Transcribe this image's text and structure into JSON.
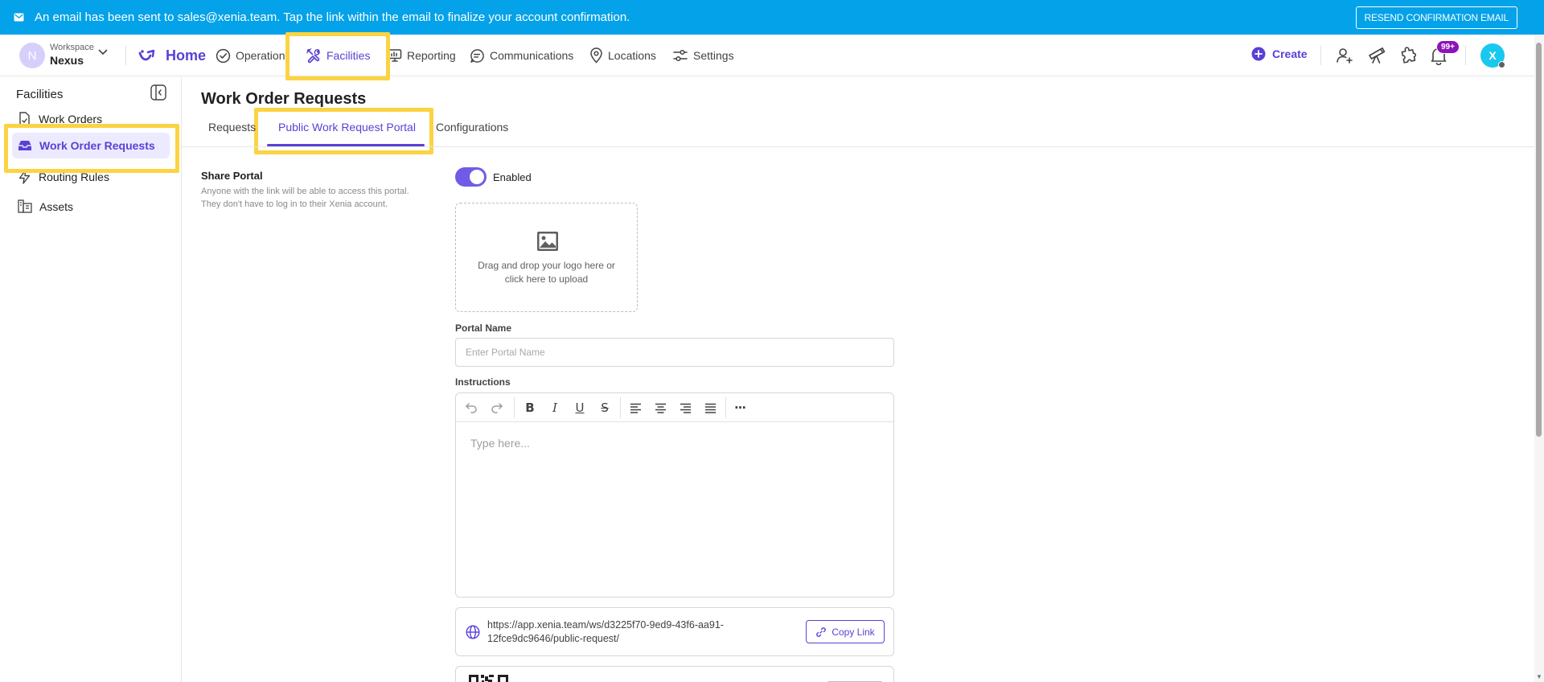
{
  "banner": {
    "message": "An email has been sent to sales@xenia.team. Tap the link within the email to finalize your account confirmation.",
    "resend_label": "RESEND CONFIRMATION EMAIL"
  },
  "workspace": {
    "initial": "N",
    "label": "Workspace",
    "name": "Nexus"
  },
  "nav": {
    "home": "Home",
    "operations": "Operations",
    "facilities": "Facilities",
    "reporting": "Reporting",
    "communications": "Communications",
    "locations": "Locations",
    "settings": "Settings",
    "create": "Create",
    "notifications_badge": "99+",
    "user_initial": "X"
  },
  "sidebar": {
    "title": "Facilities",
    "items": [
      {
        "label": "Work Orders"
      },
      {
        "label": "Work Order Requests"
      },
      {
        "label": "Routing Rules"
      },
      {
        "label": "Assets"
      }
    ]
  },
  "main": {
    "title": "Work Order Requests",
    "tabs": [
      {
        "label": "Requests"
      },
      {
        "label": "Public Work Request Portal"
      },
      {
        "label": "Configurations"
      }
    ],
    "share": {
      "title": "Share Portal",
      "description": "Anyone with the link will be able to access this portal. They don't have to log in to their Xenia account.",
      "toggle_label": "Enabled",
      "toggle_on": true
    },
    "upload": {
      "text": "Drag and drop your logo here or click here to upload"
    },
    "portal_name": {
      "label": "Portal Name",
      "value": "",
      "placeholder": "Enter Portal Name"
    },
    "instructions": {
      "label": "Instructions",
      "placeholder": "Type here...",
      "toolbar": {
        "bold": "B",
        "italic": "I",
        "underline": "U",
        "strike": "S",
        "more": "···"
      }
    },
    "link": {
      "url": "https://app.xenia.team/ws/d3225f70-9ed9-43f6-aa91-12fce9dc9646/public-request/",
      "copy_label": "Copy Link"
    }
  },
  "colors": {
    "banner": "#03a2e9",
    "accent": "#5b40d6",
    "highlight": "#fbd343"
  }
}
